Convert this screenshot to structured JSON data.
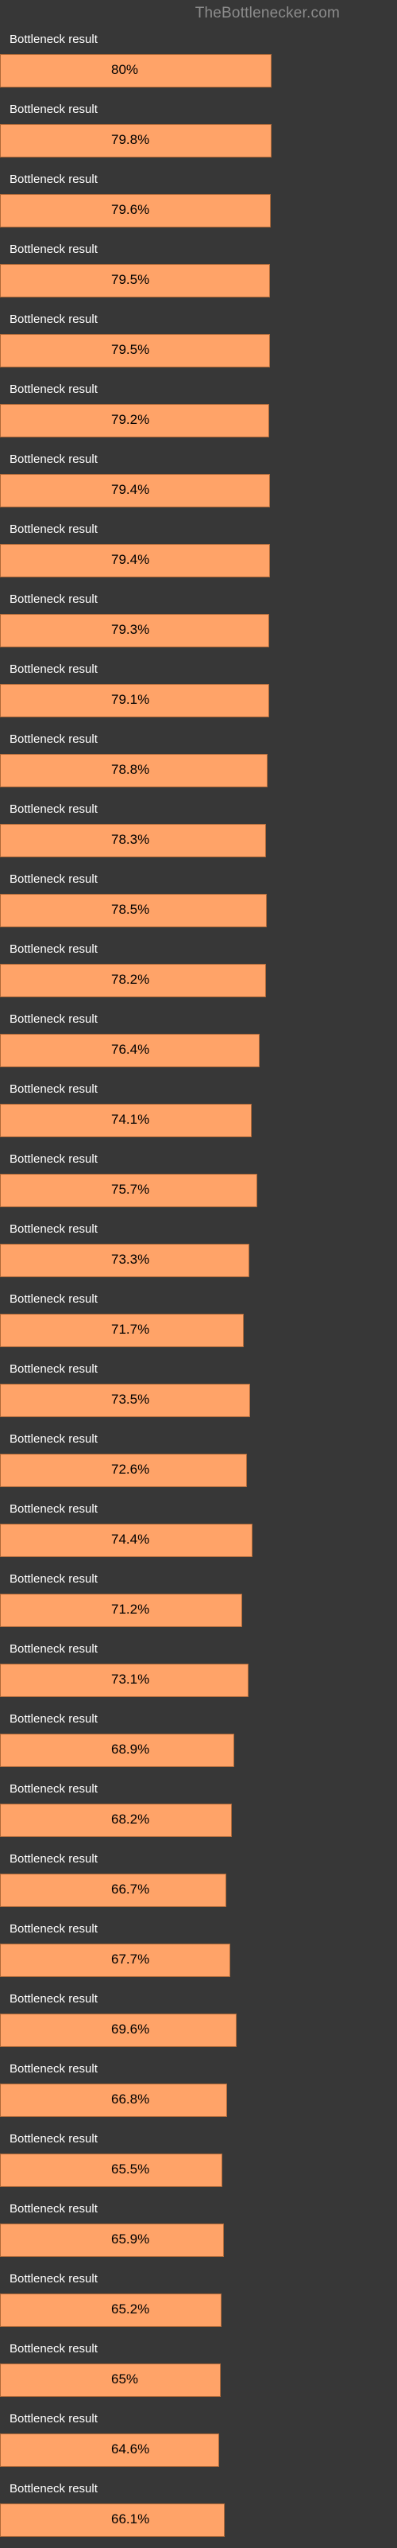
{
  "header": {
    "title": "TheBottlenecker.com"
  },
  "row_label_text": "Bottleneck result",
  "chart_data": {
    "type": "bar",
    "title": "TheBottlenecker.com",
    "xlabel": "",
    "ylabel": "Bottleneck result",
    "xlim": [
      0,
      100
    ],
    "unit": "%",
    "categories": [
      "Bottleneck result",
      "Bottleneck result",
      "Bottleneck result",
      "Bottleneck result",
      "Bottleneck result",
      "Bottleneck result",
      "Bottleneck result",
      "Bottleneck result",
      "Bottleneck result",
      "Bottleneck result",
      "Bottleneck result",
      "Bottleneck result",
      "Bottleneck result",
      "Bottleneck result",
      "Bottleneck result",
      "Bottleneck result",
      "Bottleneck result",
      "Bottleneck result",
      "Bottleneck result",
      "Bottleneck result",
      "Bottleneck result",
      "Bottleneck result",
      "Bottleneck result",
      "Bottleneck result",
      "Bottleneck result",
      "Bottleneck result",
      "Bottleneck result",
      "Bottleneck result",
      "Bottleneck result",
      "Bottleneck result",
      "Bottleneck result",
      "Bottleneck result",
      "Bottleneck result",
      "Bottleneck result",
      "Bottleneck result",
      "Bottleneck result"
    ],
    "values": [
      80.0,
      79.8,
      79.6,
      79.5,
      79.5,
      79.2,
      79.4,
      79.4,
      79.3,
      79.1,
      78.8,
      78.3,
      78.5,
      78.2,
      76.4,
      74.1,
      75.7,
      73.3,
      71.7,
      73.5,
      72.6,
      74.4,
      71.2,
      73.1,
      68.9,
      68.2,
      66.7,
      67.7,
      69.6,
      66.8,
      65.5,
      65.9,
      65.2,
      65.0,
      64.6,
      66.1
    ],
    "display": [
      "80%",
      "79.8%",
      "79.6%",
      "79.5%",
      "79.5%",
      "79.2%",
      "79.4%",
      "79.4%",
      "79.3%",
      "79.1%",
      "78.8%",
      "78.3%",
      "78.5%",
      "78.2%",
      "76.4%",
      "74.1%",
      "75.7%",
      "73.3%",
      "71.7%",
      "73.5%",
      "72.6%",
      "74.4%",
      "71.2%",
      "73.1%",
      "68.9%",
      "68.2%",
      "66.7%",
      "67.7%",
      "69.6%",
      "66.8%",
      "65.5%",
      "65.9%",
      "65.2%",
      "65%",
      "64.6%",
      "66.1%"
    ]
  },
  "colors": {
    "bar_fill": "#ffa368",
    "bar_border": "#b06a39",
    "background": "#373737",
    "header_text": "#8c8c8c"
  }
}
